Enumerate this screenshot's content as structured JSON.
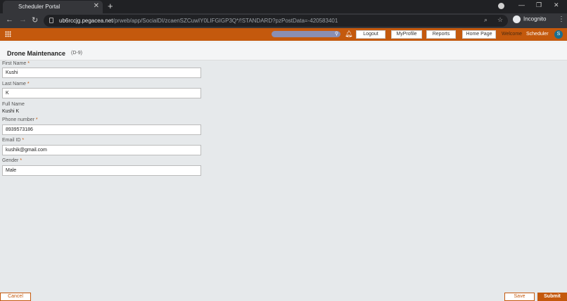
{
  "browser": {
    "tab_title": "Scheduler Portal",
    "tab_close_icon": "close-icon",
    "new_tab_icon": "plus-icon",
    "url_host": "ub6rccjg.pegacea.net",
    "url_path": "/prweb/app/SocialDI/zcaenSZCuwIY0LIFGIGP3Q*/!STANDARD?pzPostData=-420583401",
    "incognito_label": "Incognito"
  },
  "header": {
    "search_placeholder": "",
    "logout": "Logout",
    "my_profile": "MyProfile",
    "reports": "Reports",
    "home_page": "Home Page",
    "welcome": "Welcome",
    "user_name": "Scheduler",
    "avatar_initial": "S",
    "accent_color": "#c4590d"
  },
  "case": {
    "title": "Drone Maintenance",
    "id": "(D-9)"
  },
  "form": {
    "first_name": {
      "label": "First Name",
      "value": "Kushi",
      "required": "*"
    },
    "last_name": {
      "label": "Last Name",
      "value": "K",
      "required": "*"
    },
    "full_name": {
      "label": "Full Name",
      "value": "Kushi K"
    },
    "phone": {
      "label": "Phone number",
      "value": "8939573186",
      "required": "*"
    },
    "email": {
      "label": "Email ID",
      "value": "kushik@gmail.com",
      "required": "*"
    },
    "gender": {
      "label": "Gender",
      "value": "Male",
      "required": "*"
    }
  },
  "footer": {
    "cancel": "Cancel",
    "save": "Save",
    "submit": "Submit"
  }
}
